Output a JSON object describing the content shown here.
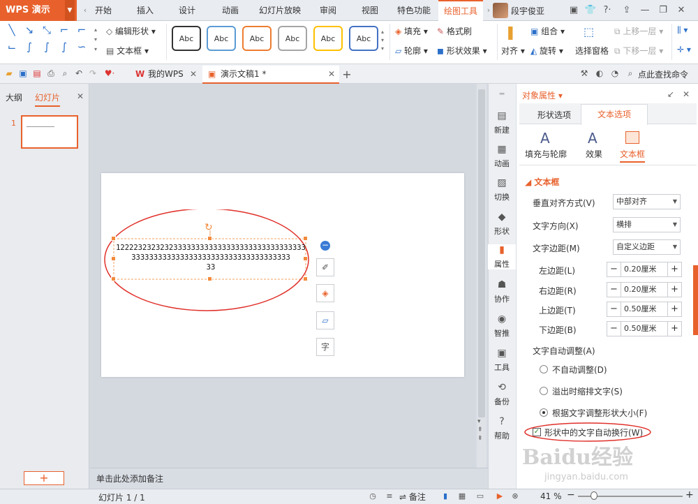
{
  "app": {
    "title": "WPS 演示"
  },
  "menu_tabs": [
    "开始",
    "插入",
    "设计",
    "动画",
    "幻灯片放映",
    "审阅",
    "视图",
    "特色功能",
    "绘图工具"
  ],
  "user": {
    "name": "段宇俊亚"
  },
  "ribbon": {
    "edit_shape": "编辑形状",
    "text_box": "文本框",
    "style_labels": [
      "Abc",
      "Abc",
      "Abc",
      "Abc",
      "Abc",
      "Abc"
    ],
    "fill": "填充",
    "format_painter": "格式刷",
    "outline": "轮廓",
    "shape_effects": "形状效果",
    "align": "对齐",
    "group": "组合",
    "rotate": "旋转",
    "selection_pane": "选择窗格",
    "bring_forward": "上移一层",
    "send_backward": "下移一层",
    "find_command": "点此查找命令"
  },
  "doc_tabs": [
    {
      "label": "我的WPS"
    },
    {
      "label": "演示文稿1 *"
    }
  ],
  "left_panel": {
    "tab_outline": "大纲",
    "tab_slides": "幻灯片",
    "slide_number": "1"
  },
  "slide": {
    "textbox_text": "1222232323232333333333333333333333333333333333333333333333333333333333333333333\n33"
  },
  "notes_placeholder": "单击此处添加备注",
  "vertical_bar": [
    "新建",
    "动画",
    "切换",
    "形状",
    "属性",
    "协作",
    "智推",
    "工具",
    "备份",
    "帮助"
  ],
  "props": {
    "header": "对象属性",
    "tab_shape": "形状选项",
    "tab_text": "文本选项",
    "sub_fill": "填充与轮廓",
    "sub_effect": "效果",
    "sub_textbox": "文本框",
    "section": "文本框",
    "valign_label": "垂直对齐方式(V)",
    "valign_value": "中部对齐",
    "direction_label": "文字方向(X)",
    "direction_value": "横排",
    "margin_label": "文字边距(M)",
    "margin_value": "自定义边距",
    "left_label": "左边距(L)",
    "left_value": "0.20厘米",
    "right_label": "右边距(R)",
    "right_value": "0.20厘米",
    "top_label": "上边距(T)",
    "top_value": "0.50厘米",
    "bottom_label": "下边距(B)",
    "bottom_value": "0.50厘米",
    "autofit_label": "文字自动调整(A)",
    "opt_none": "不自动调整(D)",
    "opt_shrink": "溢出时缩排文字(S)",
    "opt_resize": "根据文字调整形状大小(F)",
    "wrap_label": "形状中的文字自动换行(W)"
  },
  "status": {
    "slide_info": "幻灯片 1 / 1",
    "notes": "备注",
    "zoom": "41 %"
  },
  "watermark": {
    "brand": "Baidu经验",
    "url": "jingyan.baidu.com"
  },
  "colors": {
    "accent": "#e8612c",
    "annotation": "#e0302a",
    "blue": "#2a6fc9"
  }
}
